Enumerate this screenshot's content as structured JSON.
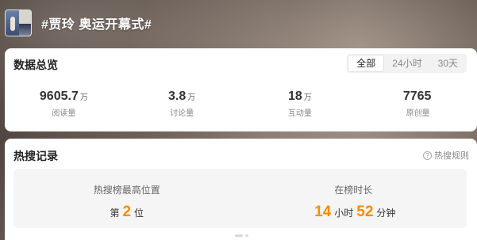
{
  "header": {
    "topic_title": "#贾玲 奥运开幕式#"
  },
  "overview": {
    "title": "数据总览",
    "tabs": [
      {
        "label": "全部",
        "active": true
      },
      {
        "label": "24小时",
        "active": false
      },
      {
        "label": "30天",
        "active": false
      }
    ],
    "stats": [
      {
        "value": "9605.7",
        "unit": "万",
        "label": "阅读量"
      },
      {
        "value": "3.8",
        "unit": "万",
        "label": "讨论量"
      },
      {
        "value": "18",
        "unit": "万",
        "label": "互动量"
      },
      {
        "value": "7765",
        "unit": "",
        "label": "原创量"
      }
    ]
  },
  "hot_search": {
    "title": "热搜记录",
    "rules_label": "热搜规则",
    "rules_icon": "question-circle-icon",
    "highest_rank": {
      "label": "热搜榜最高位置",
      "prefix": "第",
      "value": "2",
      "suffix": "位"
    },
    "duration": {
      "label": "在榜时长",
      "hours": "14",
      "hours_unit": "小时",
      "minutes": "52",
      "minutes_unit": "分钟"
    }
  },
  "colors": {
    "accent": "#ff8a00"
  }
}
